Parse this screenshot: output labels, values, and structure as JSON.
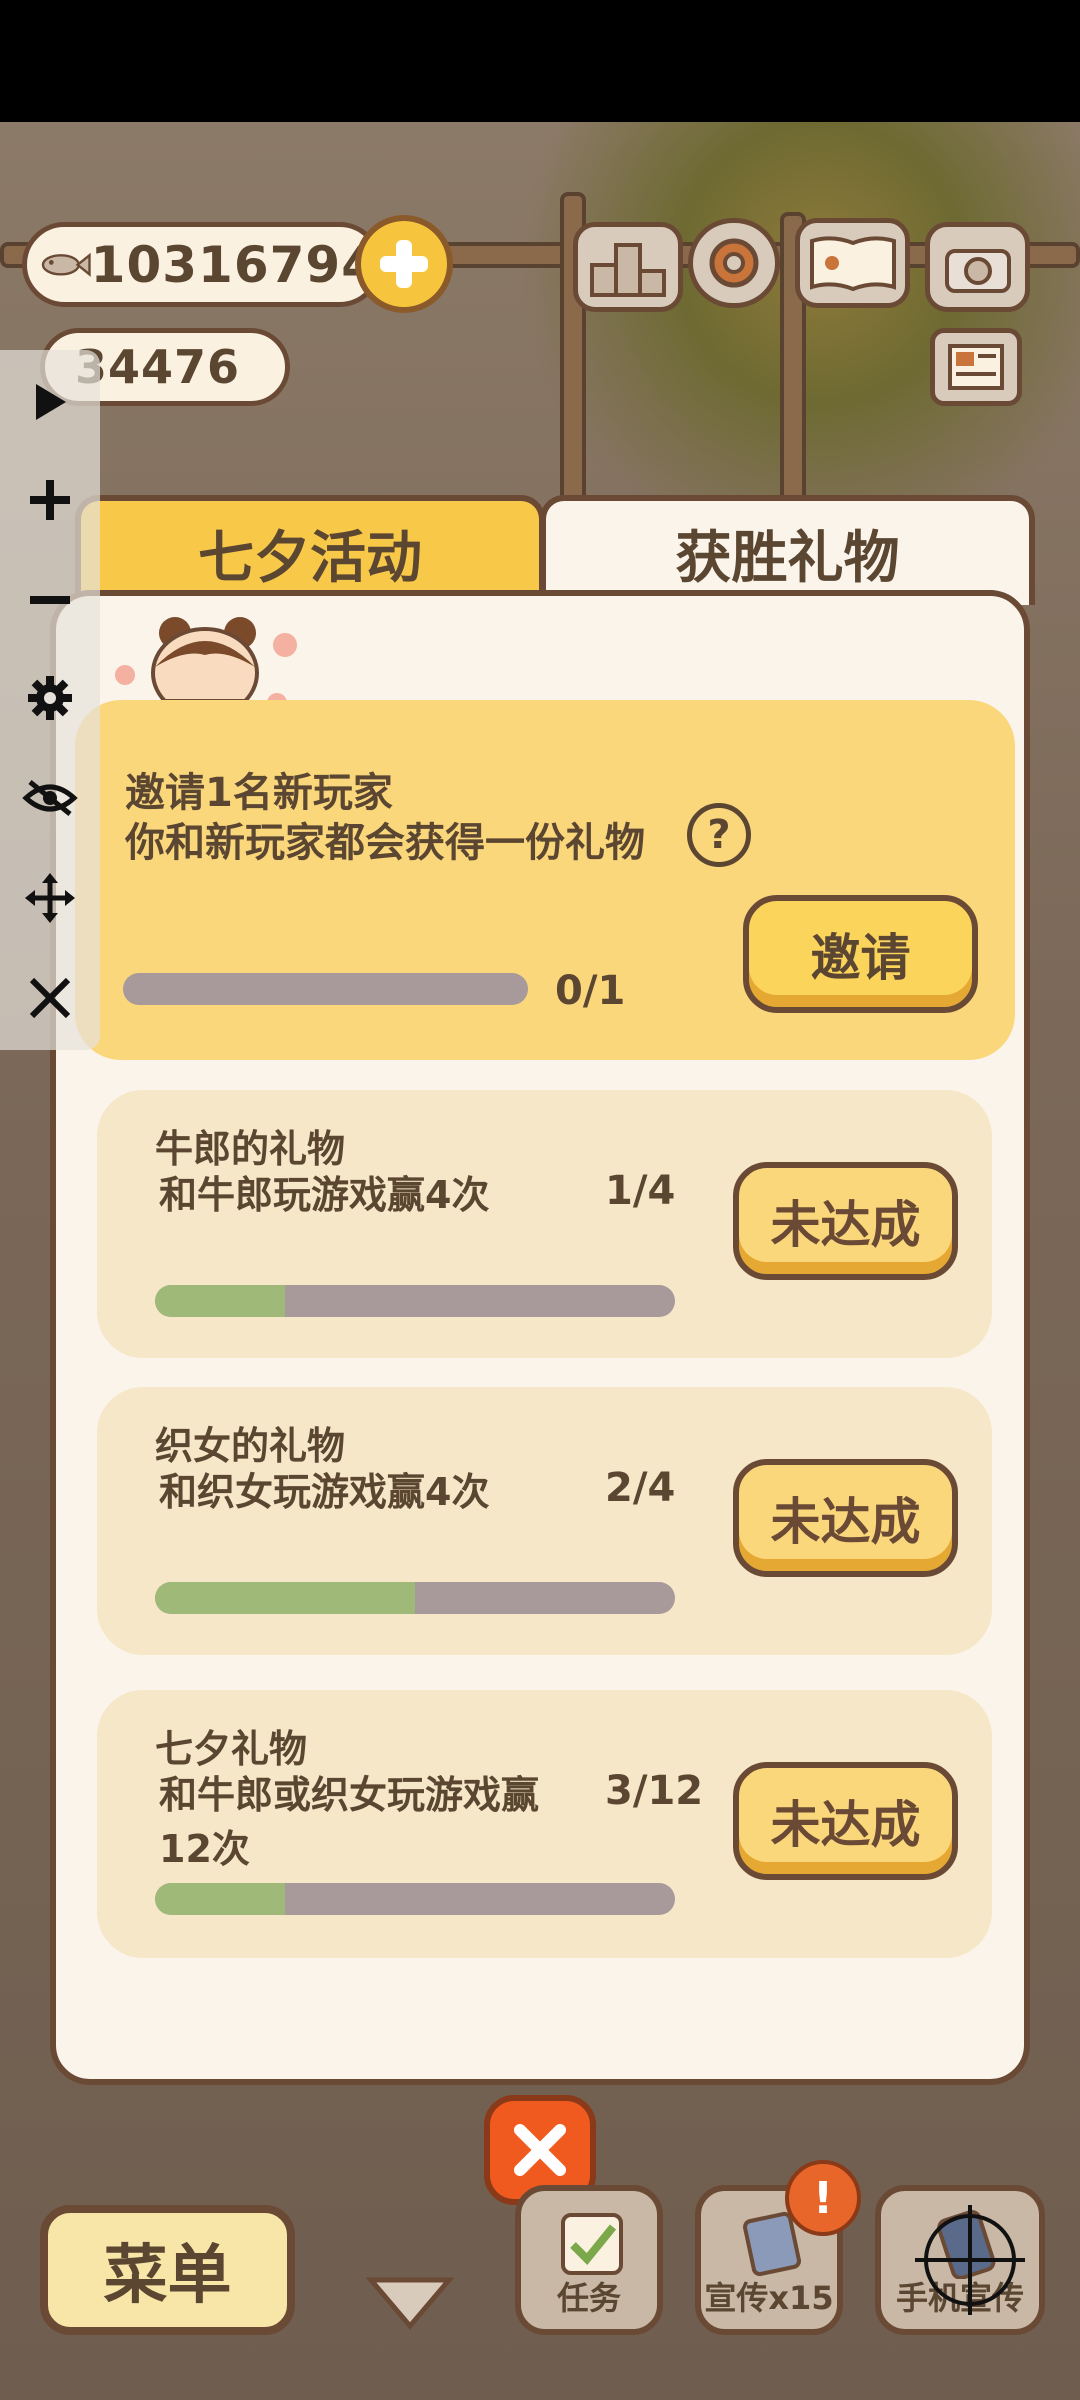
{
  "hud": {
    "fish_count": "10316794",
    "coin_count": "34476"
  },
  "tabs": {
    "event": "七夕活动",
    "gifts": "获胜礼物"
  },
  "invite": {
    "title": "邀请1名新玩家",
    "description": "你和新玩家都会获得一份礼物",
    "help_symbol": "?",
    "progress_text": "0/1",
    "progress": 0,
    "button_label": "邀请"
  },
  "tasks": [
    {
      "title": "牛郎的礼物",
      "description": "和牛郎玩游戏赢4次",
      "progress_text": "1/4",
      "progress": 0.25,
      "button_label": "未达成"
    },
    {
      "title": "织女的礼物",
      "description": "和织女玩游戏赢4次",
      "progress_text": "2/4",
      "progress": 0.5,
      "button_label": "未达成"
    },
    {
      "title": "七夕礼物",
      "description": "和牛郎或织女玩游戏赢12次",
      "progress_text": "3/12",
      "progress": 0.25,
      "button_label": "未达成"
    }
  ],
  "bottom_bar": {
    "menu": "菜单",
    "tasks": "任务",
    "promote": "宣传x15",
    "phone_promote": "手机宣传",
    "alert_symbol": "!"
  },
  "colors": {
    "accent_yellow": "#fbd45c",
    "outline_brown": "#6a4a35",
    "progress_green": "#9fb979",
    "progress_track": "#a8999a",
    "close_orange": "#f05a1e"
  }
}
